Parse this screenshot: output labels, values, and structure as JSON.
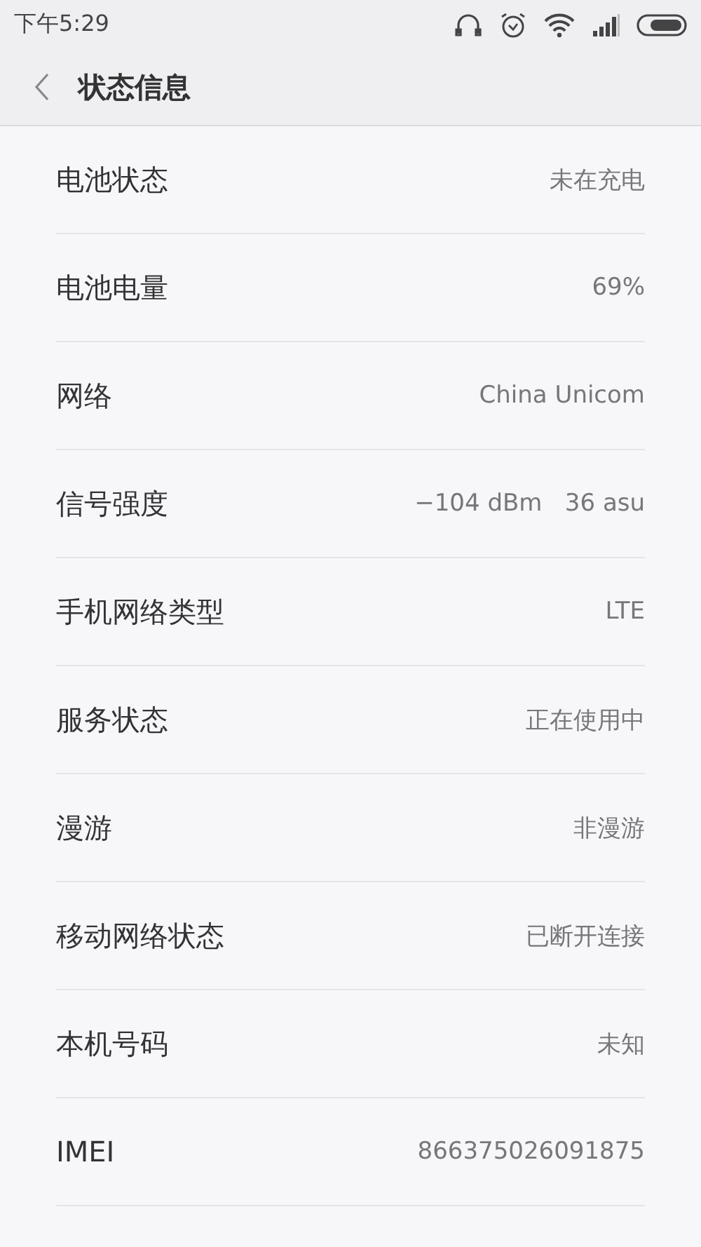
{
  "status_bar": {
    "time": "下午5:29"
  },
  "header": {
    "title": "状态信息"
  },
  "rows": [
    {
      "label": "电池状态",
      "value": "未在充电"
    },
    {
      "label": "电池电量",
      "value": "69%"
    },
    {
      "label": "网络",
      "value": "China Unicom"
    },
    {
      "label": "信号强度",
      "value": "−104 dBm   36 asu"
    },
    {
      "label": "手机网络类型",
      "value": "LTE"
    },
    {
      "label": "服务状态",
      "value": "正在使用中"
    },
    {
      "label": "漫游",
      "value": "非漫游"
    },
    {
      "label": "移动网络状态",
      "value": "已断开连接"
    },
    {
      "label": "本机号码",
      "value": "未知"
    },
    {
      "label": "IMEI",
      "value": "866375026091875"
    }
  ]
}
